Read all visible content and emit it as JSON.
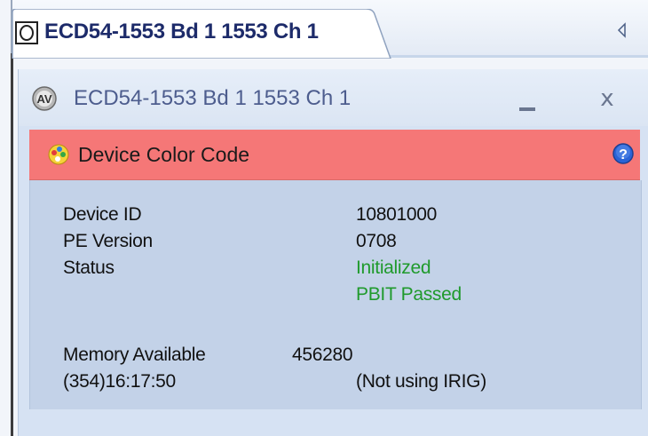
{
  "tab": {
    "title": "ECD54-1553 Bd 1 1553 Ch 1",
    "icon": "device-node-icon"
  },
  "window": {
    "title": "ECD54-1553 Bd 1 1553 Ch 1",
    "close_label": "x"
  },
  "banner": {
    "title": "Device Color Code",
    "background_color": "#f57777"
  },
  "info": {
    "device_id_label": "Device ID",
    "device_id_value": "10801000",
    "pe_version_label": "PE Version",
    "pe_version_value": "0708",
    "status_label": "Status",
    "status_values": [
      "Initialized",
      "PBIT Passed"
    ],
    "status_color": "#1f9a2c",
    "memory_label": "Memory Available",
    "memory_value": "456280",
    "time_value": "(354)16:17:50",
    "irig_value": "(Not using IRIG)"
  }
}
